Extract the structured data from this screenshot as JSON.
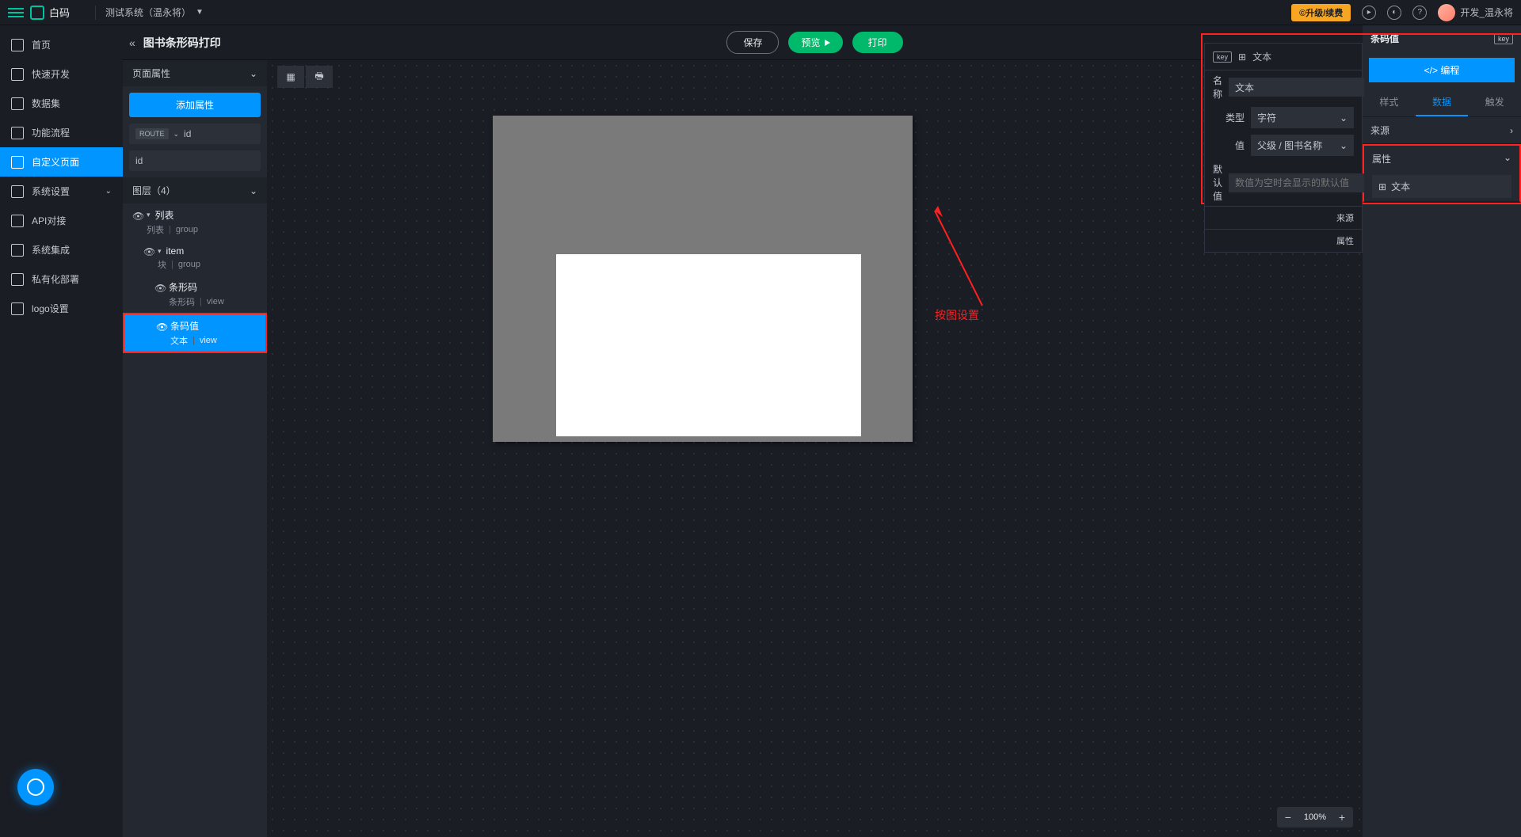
{
  "topbar": {
    "brand": "白码",
    "system": "测试系统（温永将）",
    "upgrade": "©升级/续费",
    "user": "开发_温永将"
  },
  "leftnav": {
    "items": [
      {
        "label": "首页"
      },
      {
        "label": "快速开发"
      },
      {
        "label": "数据集"
      },
      {
        "label": "功能流程"
      },
      {
        "label": "自定义页面"
      },
      {
        "label": "系统设置"
      },
      {
        "label": "API对接"
      },
      {
        "label": "系统集成"
      },
      {
        "label": "私有化部署"
      },
      {
        "label": "logo设置"
      }
    ]
  },
  "page": {
    "title": "图书条形码打印",
    "save": "保存",
    "preview": "预览",
    "print": "打印"
  },
  "secpanel": {
    "section1": "页面属性",
    "add_attr": "添加属性",
    "route_badge": "ROUTE",
    "attr_name": "id",
    "attr_input": "id",
    "section2": "图层（4）",
    "layers": [
      {
        "name": "列表",
        "sub1": "列表",
        "sub2": "group",
        "indent": 0
      },
      {
        "name": "item",
        "sub1": "块",
        "sub2": "group",
        "indent": 1
      },
      {
        "name": "条形码",
        "sub1": "条形码",
        "sub2": "view",
        "indent": 2
      },
      {
        "name": "条码值",
        "sub1": "文本",
        "sub2": "view",
        "indent": 2
      }
    ]
  },
  "right": {
    "head": "条码值",
    "code_btn": "</>  编程",
    "tabs": [
      "样式",
      "数据",
      "触发"
    ],
    "source": "来源",
    "attr": "属性",
    "text_item": "文本"
  },
  "popup": {
    "head": "文本",
    "name_label": "名称",
    "name_value": "文本",
    "type_label": "类型",
    "type_value": "字符",
    "value_label": "值",
    "value_value": "父级 / 图书名称",
    "default_label": "默认值",
    "default_placeholder": "数值为空时会显示的默认值",
    "mini_source": "来源",
    "mini_attr": "属性"
  },
  "zoom": "100%",
  "annotation": "按图设置"
}
